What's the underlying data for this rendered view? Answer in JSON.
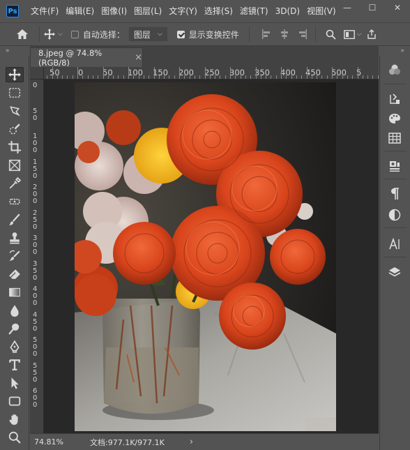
{
  "app": {
    "logo": "Ps"
  },
  "menu": [
    "文件(F)",
    "编辑(E)",
    "图像(I)",
    "图层(L)",
    "文字(Y)",
    "选择(S)",
    "滤镜(T)",
    "3D(D)",
    "视图(V)"
  ],
  "window_controls": {
    "minimize": "—",
    "maximize": "☐",
    "close": "✕"
  },
  "options_bar": {
    "auto_select_label": "自动选择：",
    "auto_select_checked": false,
    "layer_dropdown_value": "图层",
    "show_transform_label": "显示变换控件",
    "show_transform_checked": true
  },
  "panel_collapse": "»",
  "document": {
    "tab_title": "8.jpeg @ 74.8%(RGB/8)",
    "tab_close": "×"
  },
  "ruler": {
    "h_labels": [
      "50",
      "0",
      "50",
      "100",
      "150",
      "200",
      "250",
      "300",
      "350",
      "400",
      "450",
      "500",
      "5"
    ],
    "v_labels": [
      "0",
      "5 0",
      "1 0 0",
      "1 5 0",
      "2 0 0",
      "2 5 0",
      "3 0 0",
      "3 5 0",
      "4 0 0",
      "4 5 0",
      "5 0 0",
      "5 5 0",
      "6 0 0"
    ]
  },
  "status": {
    "zoom": "74.81%",
    "doc_info": "文档:977.1K/977.1K",
    "arrow": "›"
  },
  "tools": [
    "move-tool",
    "marquee-tool",
    "lasso-tool",
    "quick-select-tool",
    "crop-tool",
    "frame-tool",
    "eyedropper-tool",
    "spot-healing-tool",
    "brush-tool",
    "clone-stamp-tool",
    "history-brush-tool",
    "eraser-tool",
    "gradient-tool",
    "blur-tool",
    "dodge-tool",
    "pen-tool",
    "type-tool",
    "path-select-tool",
    "rectangle-tool",
    "hand-tool",
    "zoom-tool"
  ],
  "right_panels": [
    "color-icon",
    "history-icon",
    "swatches-icon",
    "grid-icon",
    "libraries-icon",
    "paragraph-icon",
    "adjustments-icon",
    "character-icon",
    "layers-icon"
  ],
  "colors": {
    "accent": "#31a8ff",
    "chrome": "#535353",
    "canvas": "#282828"
  }
}
